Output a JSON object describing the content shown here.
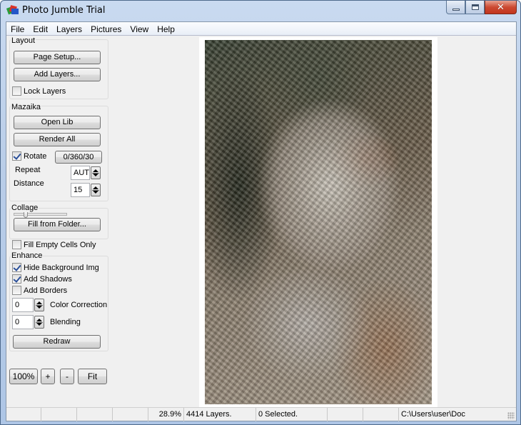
{
  "window": {
    "title": "Photo Jumble Trial",
    "app_icon": "photo-jumble-app-icon",
    "controls": {
      "minimize": "minimize-icon",
      "maximize": "maximize-icon",
      "close": "close-icon",
      "close_glyph": "✕"
    }
  },
  "menu": {
    "items": [
      {
        "label": "File"
      },
      {
        "label": "Edit"
      },
      {
        "label": "Layers"
      },
      {
        "label": "Pictures"
      },
      {
        "label": "View"
      },
      {
        "label": "Help"
      }
    ]
  },
  "layout_group": {
    "label": "Layout",
    "page_setup": "Page Setup...",
    "add_layers": "Add Layers...",
    "lock_layers": {
      "label": "Lock Layers",
      "checked": false
    }
  },
  "mazaika_group": {
    "label": "Mazaika",
    "open_lib": "Open Lib",
    "render_all": "Render All",
    "rotate": {
      "label": "Rotate",
      "checked": true
    },
    "rotate_value": "0/360/30",
    "repeat": {
      "label": "Repeat",
      "value": "AUTO"
    },
    "distance": {
      "label": "Distance",
      "value": "15",
      "slider_fraction": 0.2
    }
  },
  "collage_group": {
    "label": "Collage",
    "fill_from_folder": "Fill from Folder...",
    "fill_empty_cells": {
      "label": "Fill Empty Cells Only",
      "checked": false
    }
  },
  "enhance_group": {
    "label": "Enhance",
    "hide_background": {
      "label": "Hide Background Img",
      "checked": true
    },
    "add_shadows": {
      "label": "Add Shadows",
      "checked": true
    },
    "add_borders": {
      "label": "Add Borders",
      "checked": false
    },
    "color_correction": {
      "label": "Color Correction",
      "value": "0"
    },
    "blending": {
      "label": "Blending",
      "value": "0"
    },
    "redraw": "Redraw"
  },
  "zoom_controls": {
    "zoom_100": "100%",
    "zoom_in": "+",
    "zoom_out": "-",
    "fit": "Fit"
  },
  "canvas": {
    "description": "Photo mosaic of a woman's face composed of many small tiles"
  },
  "status": {
    "cells": [
      "",
      "",
      "",
      "",
      "28.9%",
      "4414 Layers.",
      "0 Selected.",
      "",
      "",
      "C:\\Users\\user\\Doc"
    ]
  }
}
